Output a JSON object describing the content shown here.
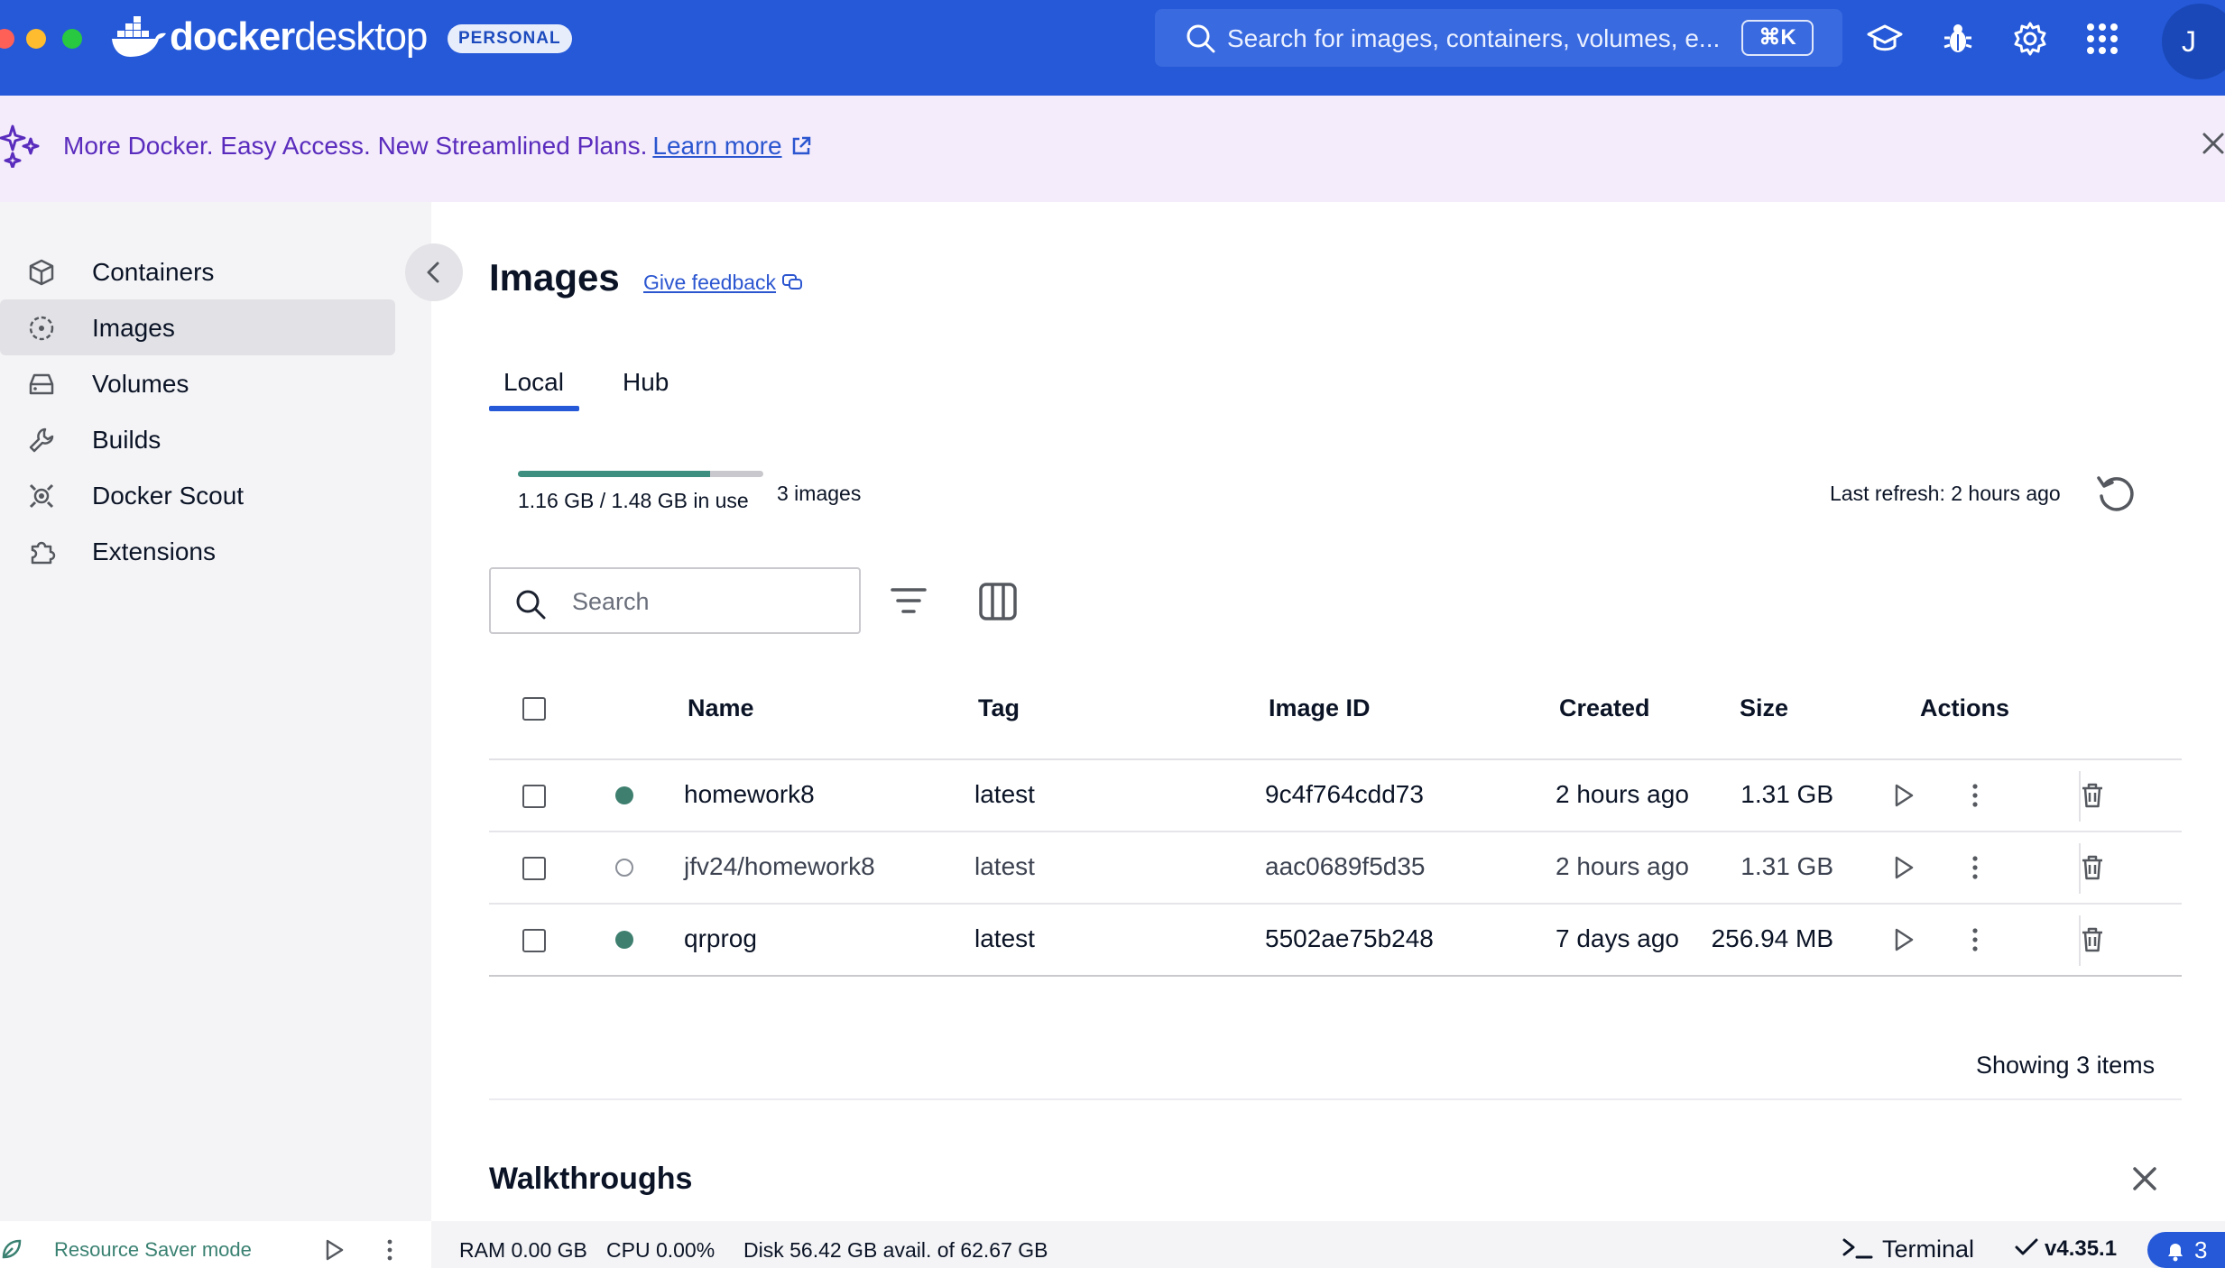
{
  "app": {
    "brand_bold": "docker",
    "brand_thin": "desktop",
    "plan_badge": "PERSONAL",
    "global_search_placeholder": "Search for images, containers, volumes, e...",
    "search_shortcut": "⌘K",
    "avatar_initial": "J",
    "topbar_icons": [
      "learning-center-icon",
      "troubleshoot-bug-icon",
      "settings-gear-icon",
      "extensions-grid-icon"
    ]
  },
  "banner": {
    "text": "More Docker. Easy Access. New Streamlined Plans.",
    "link": "Learn more"
  },
  "sidebar": {
    "items": [
      {
        "label": "Containers",
        "icon": "containers-icon"
      },
      {
        "label": "Images",
        "icon": "images-icon",
        "active": true
      },
      {
        "label": "Volumes",
        "icon": "volumes-icon"
      },
      {
        "label": "Builds",
        "icon": "builds-wrench-icon"
      },
      {
        "label": "Docker Scout",
        "icon": "docker-scout-icon"
      },
      {
        "label": "Extensions",
        "icon": "extensions-puzzle-icon"
      }
    ],
    "resource_saver": "Resource Saver mode"
  },
  "main": {
    "title": "Images",
    "feedback": "Give feedback",
    "tabs": [
      {
        "label": "Local",
        "active": true
      },
      {
        "label": "Hub"
      }
    ],
    "usage": {
      "text": "1.16 GB / 1.48 GB in use",
      "fraction": 0.784
    },
    "image_count": "3 images",
    "last_refresh": "Last refresh: 2 hours ago",
    "search_placeholder": "Search",
    "columns": [
      "Name",
      "Tag",
      "Image ID",
      "Created",
      "Size",
      "Actions"
    ],
    "rows": [
      {
        "name": "homework8",
        "tag": "latest",
        "image_id": "9c4f764cdd73",
        "created": "2 hours ago",
        "size": "1.31 GB",
        "in_use": true
      },
      {
        "name": "jfv24/homework8",
        "tag": "latest",
        "image_id": "aac0689f5d35",
        "created": "2 hours ago",
        "size": "1.31 GB",
        "in_use": false
      },
      {
        "name": "qrprog",
        "tag": "latest",
        "image_id": "5502ae75b248",
        "created": "7 days ago",
        "size": "256.94 MB",
        "in_use": true
      }
    ],
    "showing": "Showing 3 items",
    "walkthroughs": "Walkthroughs"
  },
  "footer": {
    "ram": "RAM 0.00 GB",
    "cpu": "CPU 0.00%",
    "disk": "Disk 56.42 GB avail. of 62.67 GB",
    "terminal": "Terminal",
    "version": "v4.35.1",
    "notifications": "3"
  },
  "colors": {
    "topbar": "#2559d8",
    "banner_bg": "#f4ecfb",
    "sidebar_bg": "#f4f4f6",
    "in_use_dot": "#3e7f6f",
    "usage_fill": "#3e8f7f"
  }
}
